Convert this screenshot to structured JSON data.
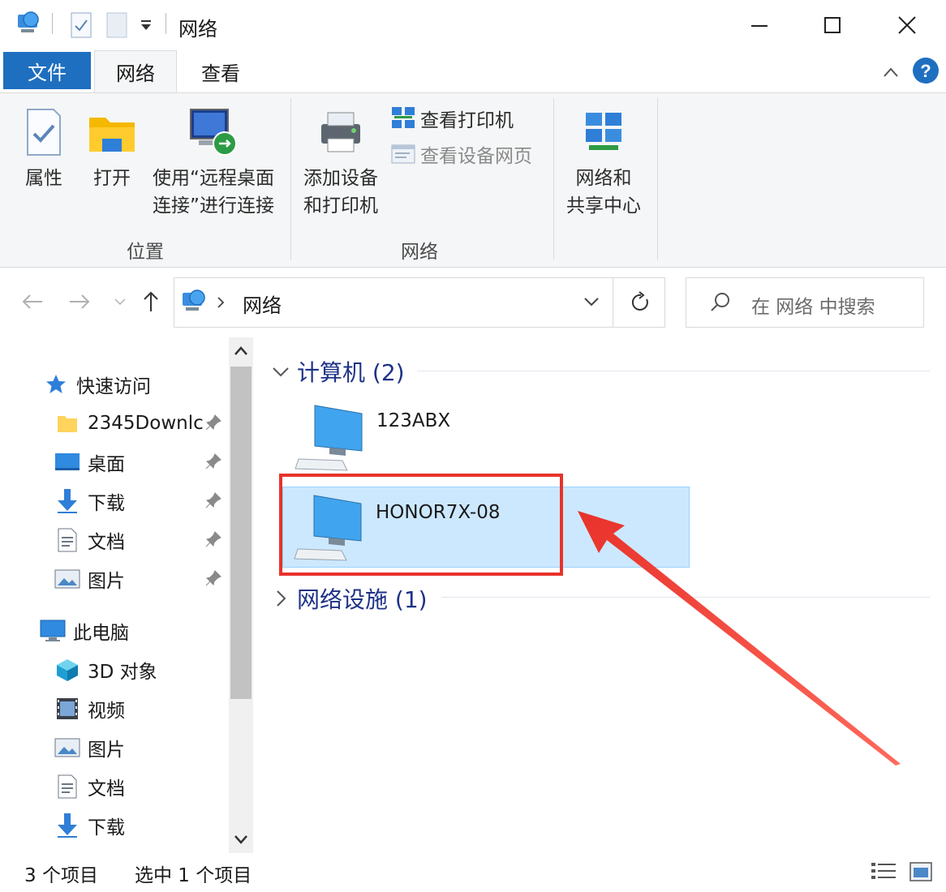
{
  "window": {
    "title": "网络"
  },
  "tabs": {
    "file": "文件",
    "network": "网络",
    "view": "查看"
  },
  "ribbon": {
    "location_group": {
      "label": "位置",
      "properties": "属性",
      "open": "打开",
      "remote_line1": "使用“远程桌面",
      "remote_line2": "连接”进行连接"
    },
    "network_group": {
      "label": "网络",
      "add_device_line1": "添加设备",
      "add_device_line2": "和打印机",
      "view_printers": "查看打印机",
      "view_device_webpage": "查看设备网页"
    },
    "sharing": {
      "line1": "网络和",
      "line2": "共享中心"
    }
  },
  "navbar": {
    "address": "网络",
    "search_placeholder": "在 网络 中搜索"
  },
  "navpane": {
    "quick_access": "快速访问",
    "quick_items": [
      "2345Downlc",
      "桌面",
      "下载",
      "文档",
      "图片"
    ],
    "this_pc": "此电脑",
    "pc_items": [
      "3D 对象",
      "视频",
      "图片",
      "文档",
      "下载"
    ]
  },
  "content": {
    "computers_group": "计算机 (2)",
    "computers": [
      "123ABX",
      "HONOR7X-08"
    ],
    "devices_group": "网络设施 (1)"
  },
  "statusbar": {
    "count": "3 个项目",
    "selected": "选中 1 个项目"
  },
  "colors": {
    "accent": "#1f6fc0",
    "selection": "#cce8ff",
    "highlight_red": "#e8322b",
    "group_header": "#1e3287"
  }
}
